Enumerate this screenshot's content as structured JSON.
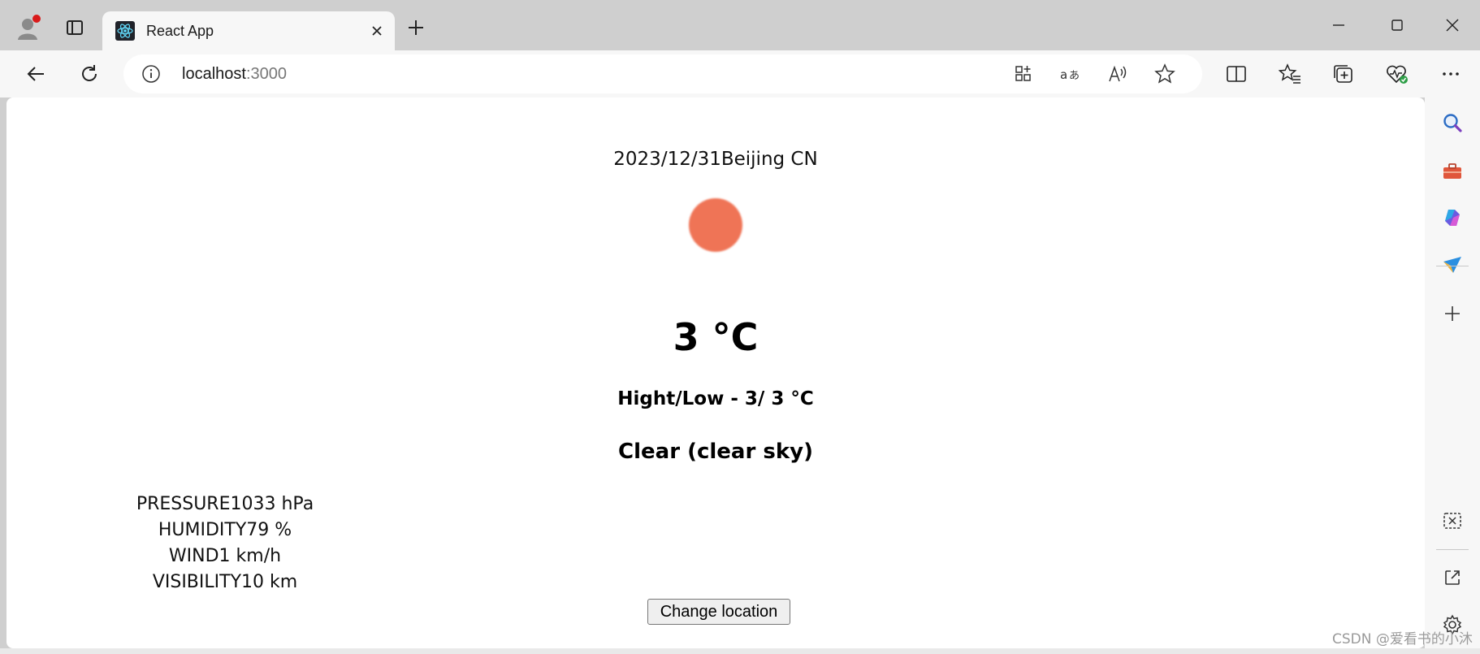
{
  "browser": {
    "tab_title": "React App",
    "url_host": "localhost",
    "url_port": ":3000"
  },
  "weather": {
    "date_city": "2023/12/31Beijing CN",
    "temperature": "3 °C",
    "high_low": "Hight/Low - 3/ 3 °C",
    "description": "Clear (clear sky)",
    "icon_color": "#ef7456",
    "stats": [
      "PRESSURE1033 hPa",
      "HUMIDITY79 %",
      "WIND1 km/h",
      "VISIBILITY10 km"
    ],
    "change_location_label": "Change location"
  },
  "watermark": "CSDN @爱看书的小沐",
  "icons": {
    "tabbar": [
      "profile-icon",
      "tab-actions-icon",
      "react-favicon",
      "close-icon",
      "plus-icon",
      "minimize-icon",
      "maximize-icon",
      "close-window-icon"
    ],
    "toolbar": [
      "back-icon",
      "reload-icon",
      "info-icon",
      "apps-icon",
      "translate-icon",
      "read-aloud-icon",
      "favorite-star-icon",
      "split-screen-icon",
      "favorites-icon",
      "collections-icon",
      "browser-essentials-icon",
      "more-icon"
    ],
    "sidebar": [
      "search-icon",
      "tools-icon",
      "copilot-icon",
      "send-icon",
      "plus-icon",
      "screenshot-icon",
      "open-external-icon",
      "settings-icon"
    ]
  }
}
